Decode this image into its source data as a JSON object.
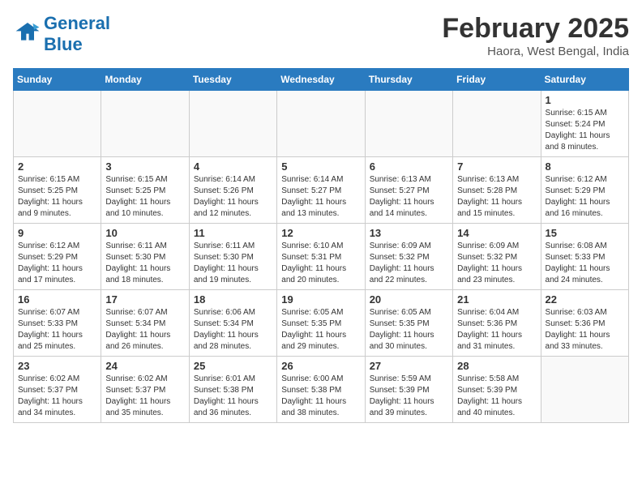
{
  "header": {
    "logo_line1": "General",
    "logo_line2": "Blue",
    "month_title": "February 2025",
    "location": "Haora, West Bengal, India"
  },
  "days_of_week": [
    "Sunday",
    "Monday",
    "Tuesday",
    "Wednesday",
    "Thursday",
    "Friday",
    "Saturday"
  ],
  "weeks": [
    [
      {
        "day": "",
        "info": ""
      },
      {
        "day": "",
        "info": ""
      },
      {
        "day": "",
        "info": ""
      },
      {
        "day": "",
        "info": ""
      },
      {
        "day": "",
        "info": ""
      },
      {
        "day": "",
        "info": ""
      },
      {
        "day": "1",
        "info": "Sunrise: 6:15 AM\nSunset: 5:24 PM\nDaylight: 11 hours and 8 minutes."
      }
    ],
    [
      {
        "day": "2",
        "info": "Sunrise: 6:15 AM\nSunset: 5:25 PM\nDaylight: 11 hours and 9 minutes."
      },
      {
        "day": "3",
        "info": "Sunrise: 6:15 AM\nSunset: 5:25 PM\nDaylight: 11 hours and 10 minutes."
      },
      {
        "day": "4",
        "info": "Sunrise: 6:14 AM\nSunset: 5:26 PM\nDaylight: 11 hours and 12 minutes."
      },
      {
        "day": "5",
        "info": "Sunrise: 6:14 AM\nSunset: 5:27 PM\nDaylight: 11 hours and 13 minutes."
      },
      {
        "day": "6",
        "info": "Sunrise: 6:13 AM\nSunset: 5:27 PM\nDaylight: 11 hours and 14 minutes."
      },
      {
        "day": "7",
        "info": "Sunrise: 6:13 AM\nSunset: 5:28 PM\nDaylight: 11 hours and 15 minutes."
      },
      {
        "day": "8",
        "info": "Sunrise: 6:12 AM\nSunset: 5:29 PM\nDaylight: 11 hours and 16 minutes."
      }
    ],
    [
      {
        "day": "9",
        "info": "Sunrise: 6:12 AM\nSunset: 5:29 PM\nDaylight: 11 hours and 17 minutes."
      },
      {
        "day": "10",
        "info": "Sunrise: 6:11 AM\nSunset: 5:30 PM\nDaylight: 11 hours and 18 minutes."
      },
      {
        "day": "11",
        "info": "Sunrise: 6:11 AM\nSunset: 5:30 PM\nDaylight: 11 hours and 19 minutes."
      },
      {
        "day": "12",
        "info": "Sunrise: 6:10 AM\nSunset: 5:31 PM\nDaylight: 11 hours and 20 minutes."
      },
      {
        "day": "13",
        "info": "Sunrise: 6:09 AM\nSunset: 5:32 PM\nDaylight: 11 hours and 22 minutes."
      },
      {
        "day": "14",
        "info": "Sunrise: 6:09 AM\nSunset: 5:32 PM\nDaylight: 11 hours and 23 minutes."
      },
      {
        "day": "15",
        "info": "Sunrise: 6:08 AM\nSunset: 5:33 PM\nDaylight: 11 hours and 24 minutes."
      }
    ],
    [
      {
        "day": "16",
        "info": "Sunrise: 6:07 AM\nSunset: 5:33 PM\nDaylight: 11 hours and 25 minutes."
      },
      {
        "day": "17",
        "info": "Sunrise: 6:07 AM\nSunset: 5:34 PM\nDaylight: 11 hours and 26 minutes."
      },
      {
        "day": "18",
        "info": "Sunrise: 6:06 AM\nSunset: 5:34 PM\nDaylight: 11 hours and 28 minutes."
      },
      {
        "day": "19",
        "info": "Sunrise: 6:05 AM\nSunset: 5:35 PM\nDaylight: 11 hours and 29 minutes."
      },
      {
        "day": "20",
        "info": "Sunrise: 6:05 AM\nSunset: 5:35 PM\nDaylight: 11 hours and 30 minutes."
      },
      {
        "day": "21",
        "info": "Sunrise: 6:04 AM\nSunset: 5:36 PM\nDaylight: 11 hours and 31 minutes."
      },
      {
        "day": "22",
        "info": "Sunrise: 6:03 AM\nSunset: 5:36 PM\nDaylight: 11 hours and 33 minutes."
      }
    ],
    [
      {
        "day": "23",
        "info": "Sunrise: 6:02 AM\nSunset: 5:37 PM\nDaylight: 11 hours and 34 minutes."
      },
      {
        "day": "24",
        "info": "Sunrise: 6:02 AM\nSunset: 5:37 PM\nDaylight: 11 hours and 35 minutes."
      },
      {
        "day": "25",
        "info": "Sunrise: 6:01 AM\nSunset: 5:38 PM\nDaylight: 11 hours and 36 minutes."
      },
      {
        "day": "26",
        "info": "Sunrise: 6:00 AM\nSunset: 5:38 PM\nDaylight: 11 hours and 38 minutes."
      },
      {
        "day": "27",
        "info": "Sunrise: 5:59 AM\nSunset: 5:39 PM\nDaylight: 11 hours and 39 minutes."
      },
      {
        "day": "28",
        "info": "Sunrise: 5:58 AM\nSunset: 5:39 PM\nDaylight: 11 hours and 40 minutes."
      },
      {
        "day": "",
        "info": ""
      }
    ]
  ]
}
